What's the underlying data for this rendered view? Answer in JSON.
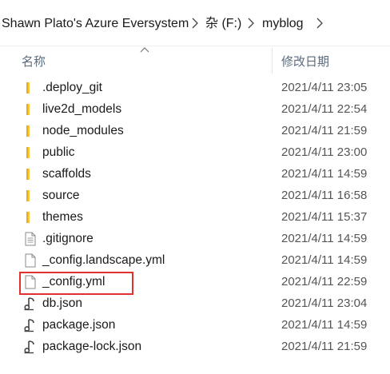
{
  "breadcrumb": {
    "items": [
      "Shawn Plato's Azure Eversystem",
      "杂 (F:)",
      "myblog"
    ]
  },
  "columns": {
    "name": "名称",
    "date": "修改日期"
  },
  "files": [
    {
      "name": ".deploy_git",
      "date": "2021/4/11 23:05",
      "type": "folder"
    },
    {
      "name": "live2d_models",
      "date": "2021/4/11 22:54",
      "type": "folder"
    },
    {
      "name": "node_modules",
      "date": "2021/4/11 21:59",
      "type": "folder"
    },
    {
      "name": "public",
      "date": "2021/4/11 23:00",
      "type": "folder"
    },
    {
      "name": "scaffolds",
      "date": "2021/4/11 14:59",
      "type": "folder"
    },
    {
      "name": "source",
      "date": "2021/4/11 16:58",
      "type": "folder"
    },
    {
      "name": "themes",
      "date": "2021/4/11 15:37",
      "type": "folder"
    },
    {
      "name": ".gitignore",
      "date": "2021/4/11 14:59",
      "type": "text-file"
    },
    {
      "name": "_config.landscape.yml",
      "date": "2021/4/11 14:59",
      "type": "file"
    },
    {
      "name": "_config.yml",
      "date": "2021/4/11 22:59",
      "type": "file"
    },
    {
      "name": "db.json",
      "date": "2021/4/11 23:04",
      "type": "json-file"
    },
    {
      "name": "package.json",
      "date": "2021/4/11 14:59",
      "type": "json-file"
    },
    {
      "name": "package-lock.json",
      "date": "2021/4/11 21:59",
      "type": "json-file"
    }
  ],
  "colors": {
    "folder": "#f8c83c",
    "highlight": "#e03030",
    "header_text": "#5a6b7d"
  }
}
